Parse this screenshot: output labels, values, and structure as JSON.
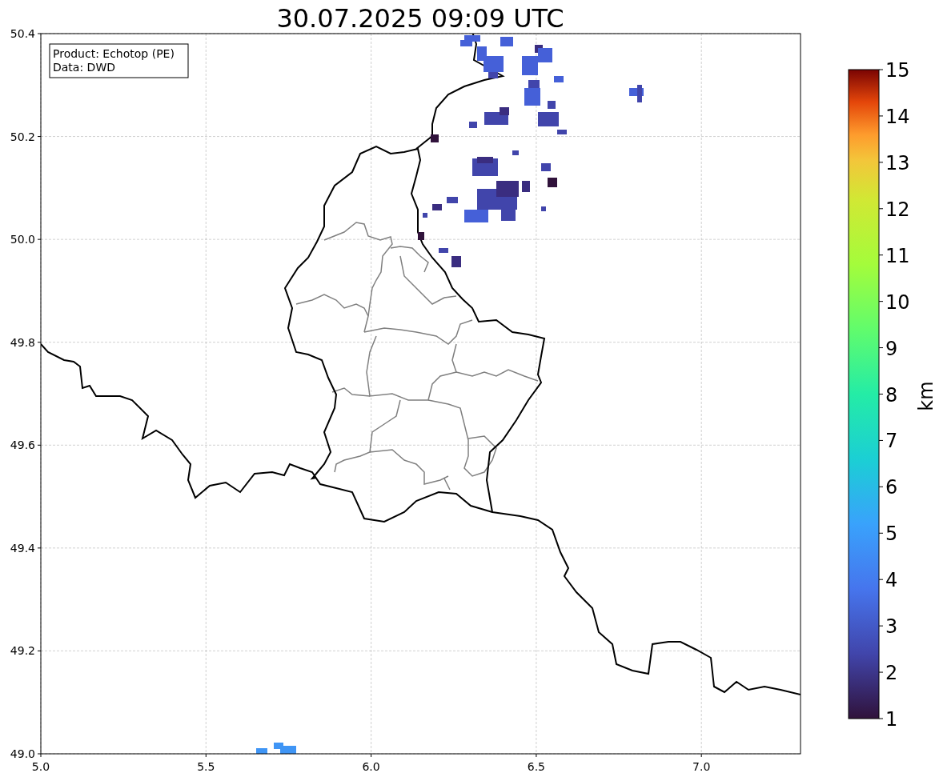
{
  "title": "30.07.2025 09:09 UTC",
  "info_box": {
    "lines": [
      "Product: Echotop (PE)",
      "Data: DWD"
    ]
  },
  "x_axis": {
    "ticks": [
      "5.0",
      "5.5",
      "6.0",
      "6.5",
      "7.0"
    ]
  },
  "y_axis": {
    "ticks": [
      "50.4",
      "50.2",
      "50.0",
      "49.8",
      "49.6",
      "49.4",
      "49.2",
      "49.0"
    ]
  },
  "colorbar": {
    "label": "km",
    "ticks": [
      "15",
      "14",
      "13",
      "12",
      "11",
      "10",
      "9",
      "8",
      "7",
      "6",
      "5",
      "4",
      "3",
      "2",
      "1"
    ]
  }
}
